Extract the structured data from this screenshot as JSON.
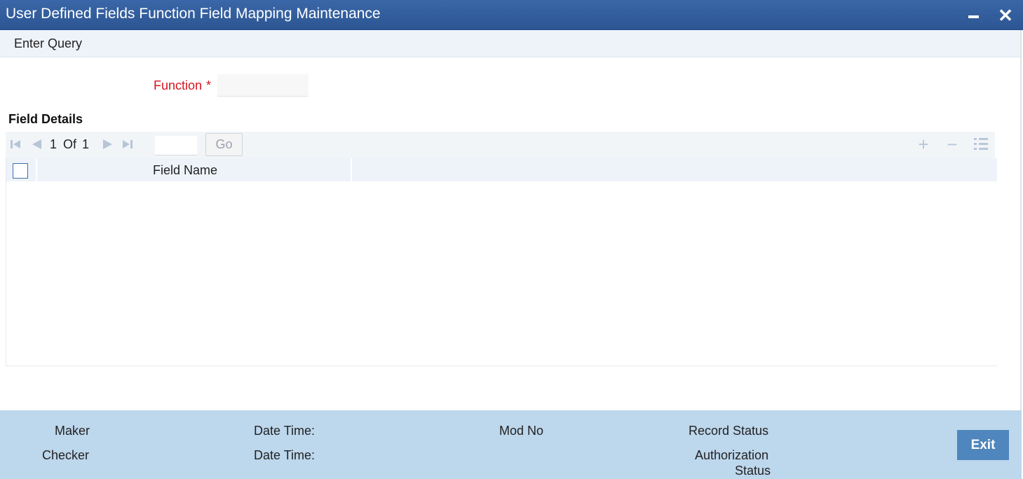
{
  "window": {
    "title": "User Defined Fields Function Field Mapping Maintenance",
    "minimize_icon": "minimize-icon",
    "close_glyph": "✕"
  },
  "menu": {
    "items": [
      {
        "label": "Enter Query"
      }
    ]
  },
  "form": {
    "function_label": "Function",
    "required_mark": "*",
    "function_value": ""
  },
  "field_details": {
    "title": "Field Details",
    "pager": {
      "current": "1",
      "of_label": "Of",
      "total": "1",
      "goto_value": "",
      "go_label": "Go"
    },
    "toolbar": {
      "add_glyph": "+",
      "remove_glyph": "−",
      "icons": [
        "add-row-icon",
        "delete-row-icon",
        "view-list-icon"
      ]
    },
    "columns": [
      "Field Name",
      ""
    ],
    "rows": []
  },
  "audit": {
    "maker_label": "Maker",
    "checker_label": "Checker",
    "date_time_label_1": "Date Time:",
    "date_time_label_2": "Date Time:",
    "mod_no_label": "Mod No",
    "record_status_label": "Record Status",
    "auth_status_line1": "Authorization",
    "auth_status_line2": "Status",
    "exit_label": "Exit"
  },
  "colors": {
    "title_bar": "#2f5a97",
    "required_label": "#d4141e",
    "footer": "#bdd7ec",
    "exit_button": "#4e86bd"
  }
}
